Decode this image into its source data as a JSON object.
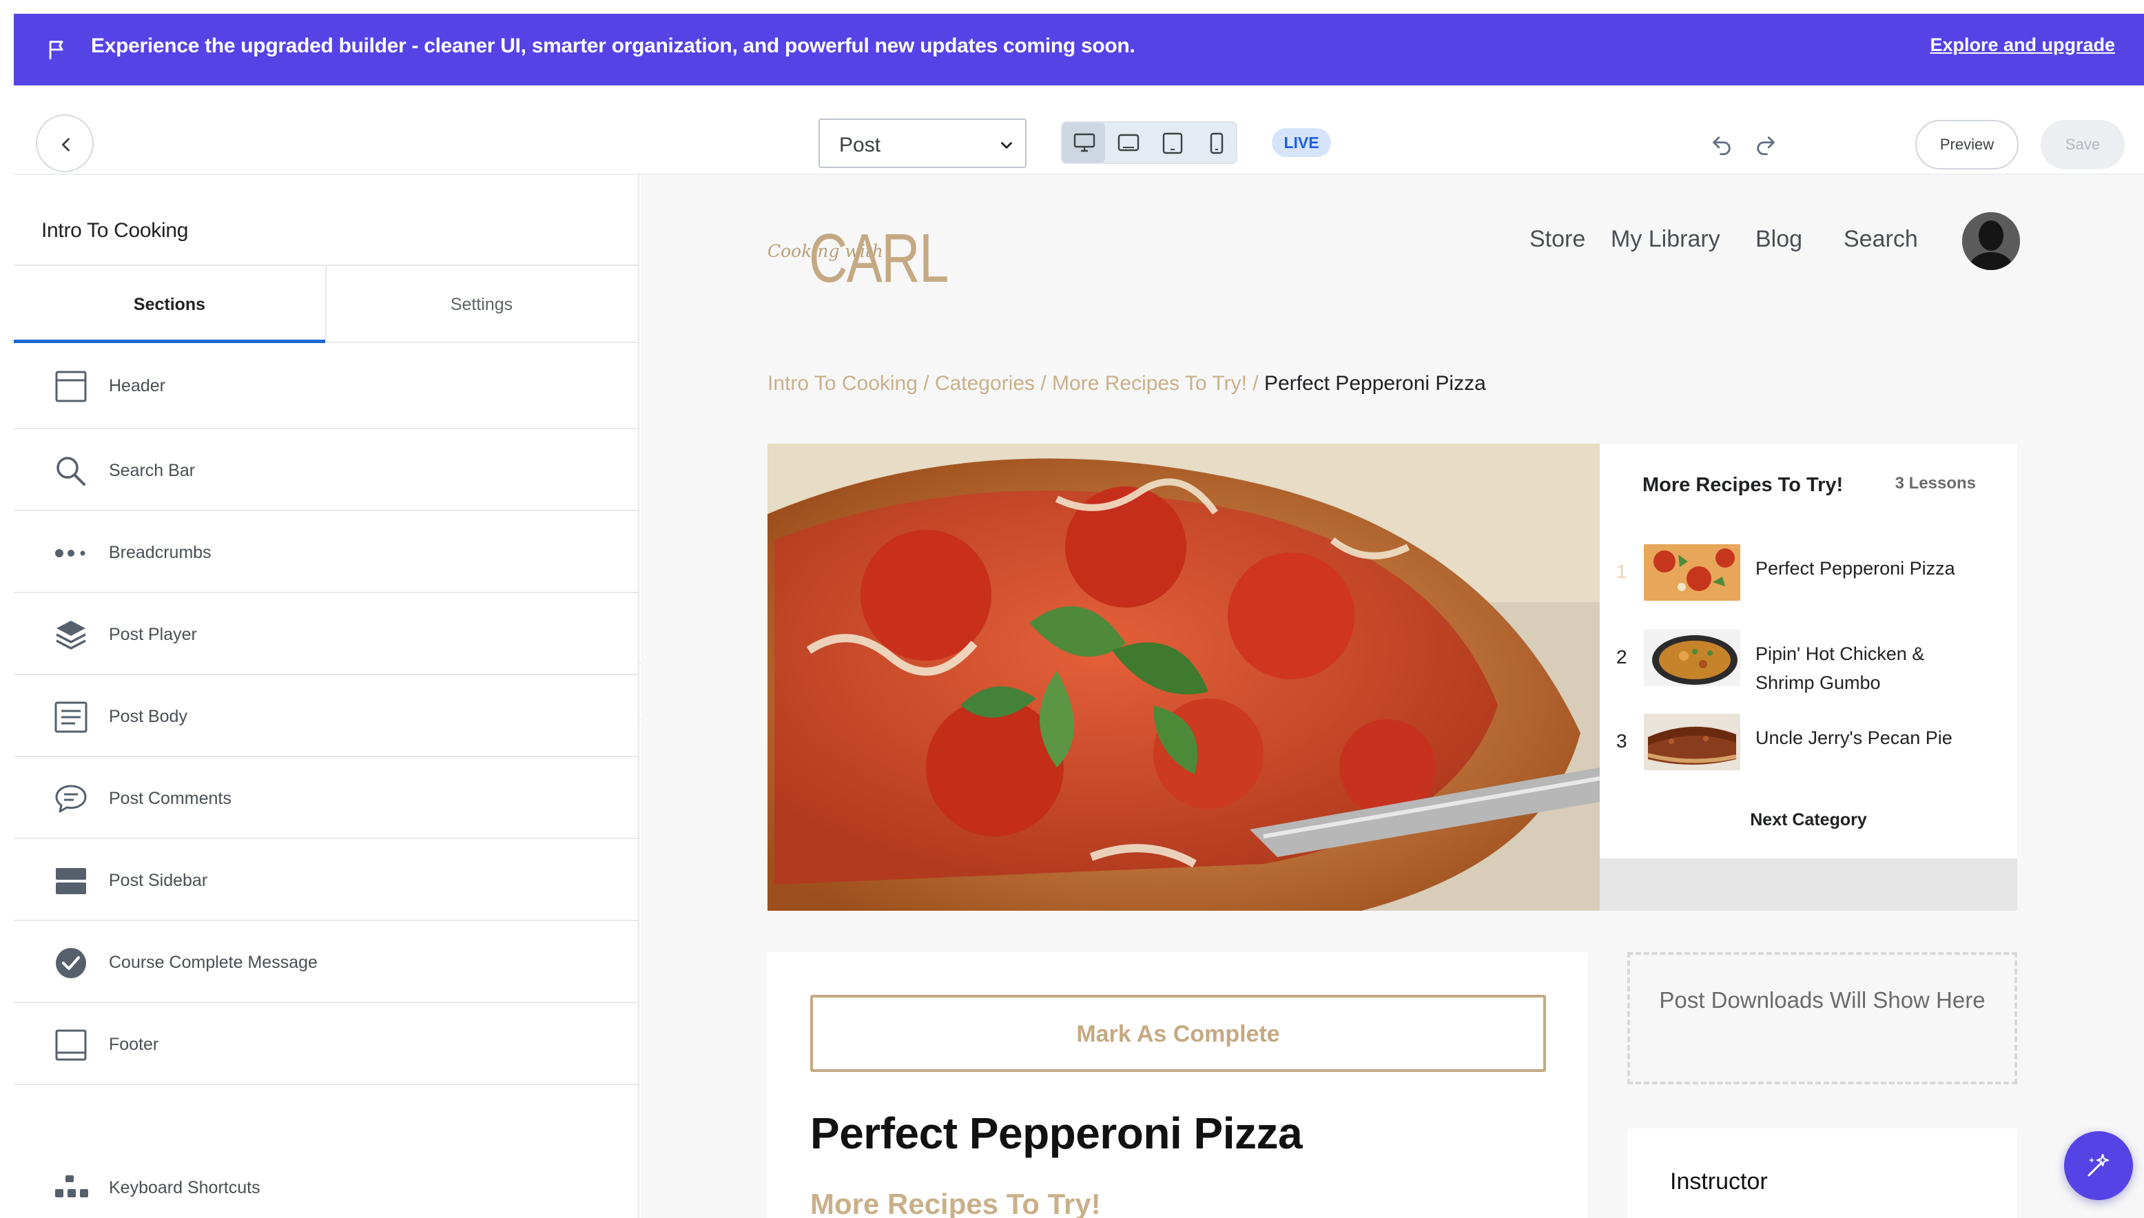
{
  "banner": {
    "message": "Experience the upgraded builder - cleaner UI, smarter organization, and powerful new updates coming soon.",
    "link": "Explore and upgrade",
    "background_color": "#5543e6"
  },
  "toolbar": {
    "page_select": "Post",
    "device_views": [
      "desktop",
      "tablet-landscape",
      "tablet-portrait",
      "mobile"
    ],
    "active_device": "desktop",
    "status_badge": "LIVE",
    "preview_label": "Preview",
    "save_label": "Save"
  },
  "sidebar": {
    "title": "Intro To Cooking",
    "tabs": [
      "Sections",
      "Settings"
    ],
    "active_tab": "Sections",
    "items": [
      {
        "label": "Header",
        "icon": "header-layout-icon"
      },
      {
        "label": "Search Bar",
        "icon": "search-icon"
      },
      {
        "label": "Breadcrumbs",
        "icon": "dots-icon"
      },
      {
        "label": "Post Player",
        "icon": "layers-icon"
      },
      {
        "label": "Post Body",
        "icon": "text-block-icon"
      },
      {
        "label": "Post Comments",
        "icon": "comment-icon"
      },
      {
        "label": "Post Sidebar",
        "icon": "sidebar-layout-icon"
      },
      {
        "label": "Course Complete Message",
        "icon": "check-circle-icon"
      },
      {
        "label": "Footer",
        "icon": "footer-layout-icon"
      }
    ],
    "keyboard_shortcuts": "Keyboard Shortcuts"
  },
  "site": {
    "logo_script": "Cooking with",
    "logo_name": "CARL",
    "nav": [
      "Store",
      "My Library",
      "Blog",
      "Search"
    ],
    "accent_color": "#c5a983"
  },
  "breadcrumb": {
    "items": [
      "Intro To Cooking",
      "Categories",
      "More Recipes To Try!"
    ],
    "current": "Perfect Pepperoni Pizza",
    "separator": " / "
  },
  "playlist": {
    "title": "More Recipes To Try!",
    "count": "3 Lessons",
    "lessons": [
      {
        "num": "1",
        "title": "Perfect Pepperoni Pizza"
      },
      {
        "num": "2",
        "title": "Pipin' Hot Chicken & Shrimp Gumbo"
      },
      {
        "num": "3",
        "title": "Uncle Jerry's Pecan Pie"
      }
    ],
    "next": "Next Category"
  },
  "post": {
    "mark_complete": "Mark As Complete",
    "title": "Perfect Pepperoni Pizza",
    "category": "More Recipes To Try!"
  },
  "downloads_placeholder": "Post Downloads Will Show Here",
  "instructor_heading": "Instructor"
}
